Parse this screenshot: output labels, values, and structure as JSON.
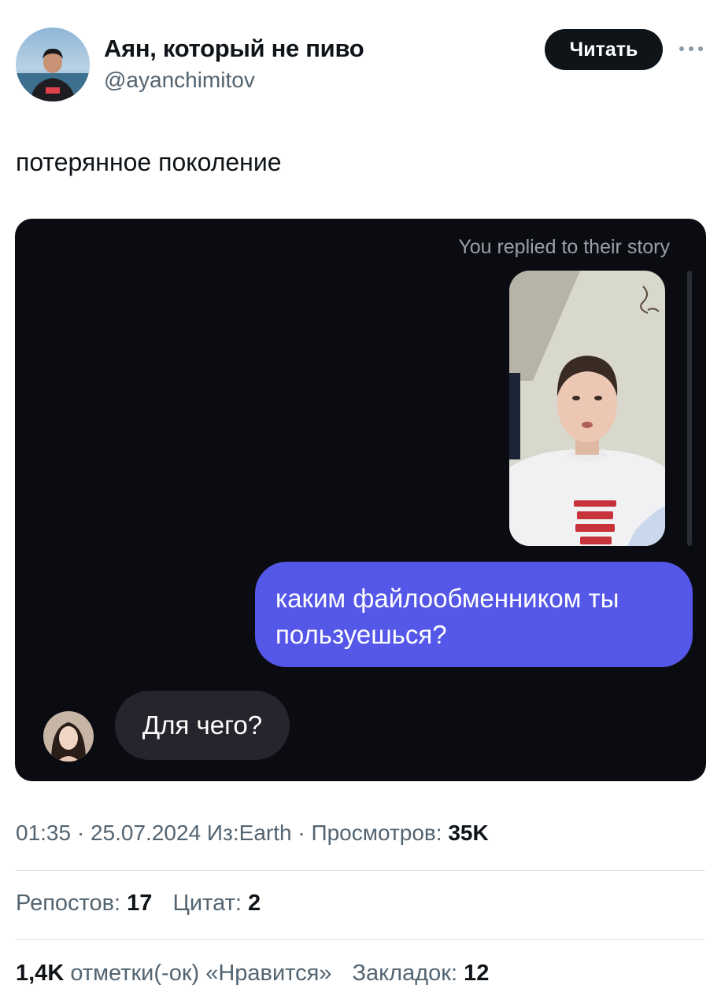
{
  "author": {
    "name": "Аян, который не пиво",
    "handle": "@ayanchimitov"
  },
  "follow_label": "Читать",
  "more_icon": "ellipsis-icon",
  "tweet_text": "потерянное поколение",
  "media": {
    "story_caption": "You replied to their story",
    "outgoing_message": "каким файлообменником ты пользуешься?",
    "incoming_message": "Для чего?",
    "colors": {
      "background": "#0b0c12",
      "outgoing_bubble": "#5457e8",
      "incoming_bubble": "#25262d"
    }
  },
  "meta": {
    "time": "01:35",
    "date": "25.07.2024",
    "source_label": "Из:",
    "source": "Earth",
    "views_label": "Просмотров:",
    "views": "35K"
  },
  "stats": {
    "reposts_label": "Репостов:",
    "reposts": "17",
    "quotes_label": "Цитат:",
    "quotes": "2",
    "likes": "1,4K",
    "likes_label": "отметки(-ок) «Нравится»",
    "bookmarks_label": "Закладок:",
    "bookmarks": "12"
  }
}
